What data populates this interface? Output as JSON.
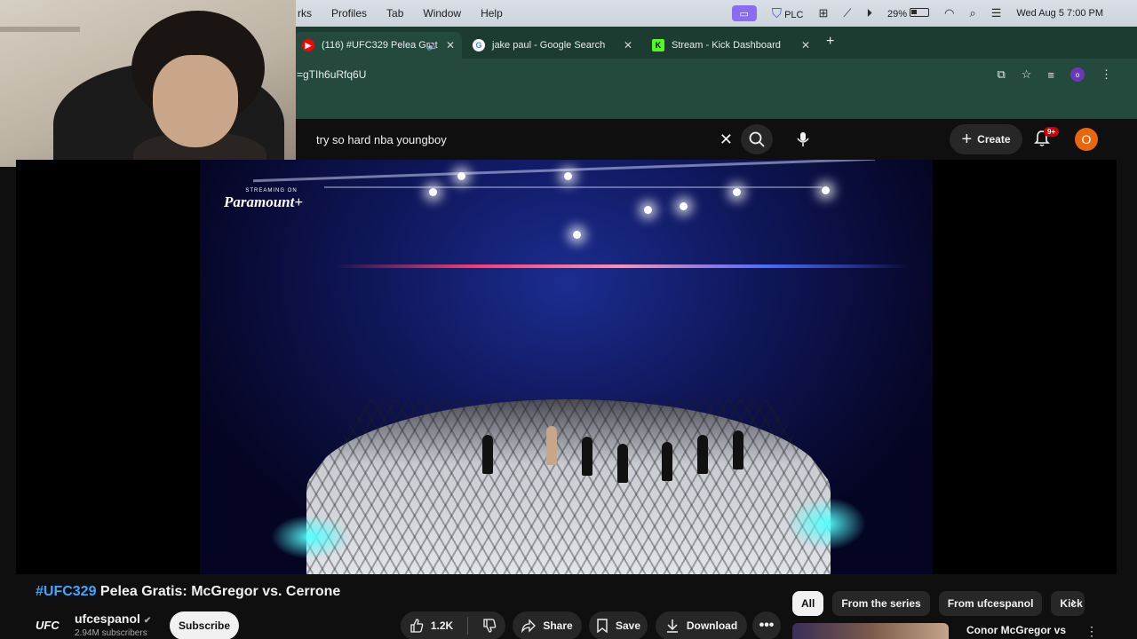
{
  "menubar": {
    "menus": [
      "rks",
      "Profiles",
      "Tab",
      "Window",
      "Help"
    ],
    "status": {
      "plc_label": "PLC",
      "battery": "29%",
      "datetime": "Wed Aug 5  7:00 PM"
    }
  },
  "browser": {
    "tabs": [
      {
        "title": "(116) #UFC329 Pelea Grat",
        "favicon": "youtube-icon",
        "active": true
      },
      {
        "title": "jake paul - Google Search",
        "favicon": "google-icon",
        "active": false
      },
      {
        "title": "Stream - Kick Dashboard",
        "favicon": "kick-icon",
        "active": false
      }
    ],
    "url": "=gTIh6uRfq6U",
    "profile_initial": "o"
  },
  "youtube": {
    "search_query": "try so hard nba youngboy",
    "create_label": "Create",
    "notifications_badge": "9+",
    "avatar_initial": "O"
  },
  "video": {
    "watermark_small": "STREAMING ON",
    "watermark_brand": "Paramount+",
    "title_tag": "#UFC329",
    "title_rest": " Pelea Gratis: McGregor vs. Cerrone",
    "channel": {
      "logo_text": "UFC",
      "name": "ufcespanol",
      "subscribers": "2.94M subscribers",
      "subscribe_label": "Subscribe"
    },
    "actions": {
      "likes": "1.2K",
      "share": "Share",
      "save": "Save",
      "download": "Download"
    }
  },
  "sidebar": {
    "chips": [
      {
        "label": "All",
        "active": true
      },
      {
        "label": "From the series",
        "active": false
      },
      {
        "label": "From ufcespanol",
        "active": false
      },
      {
        "label": "Kick",
        "active": false
      }
    ],
    "recommendation_title": "Conor McGregor vs"
  }
}
